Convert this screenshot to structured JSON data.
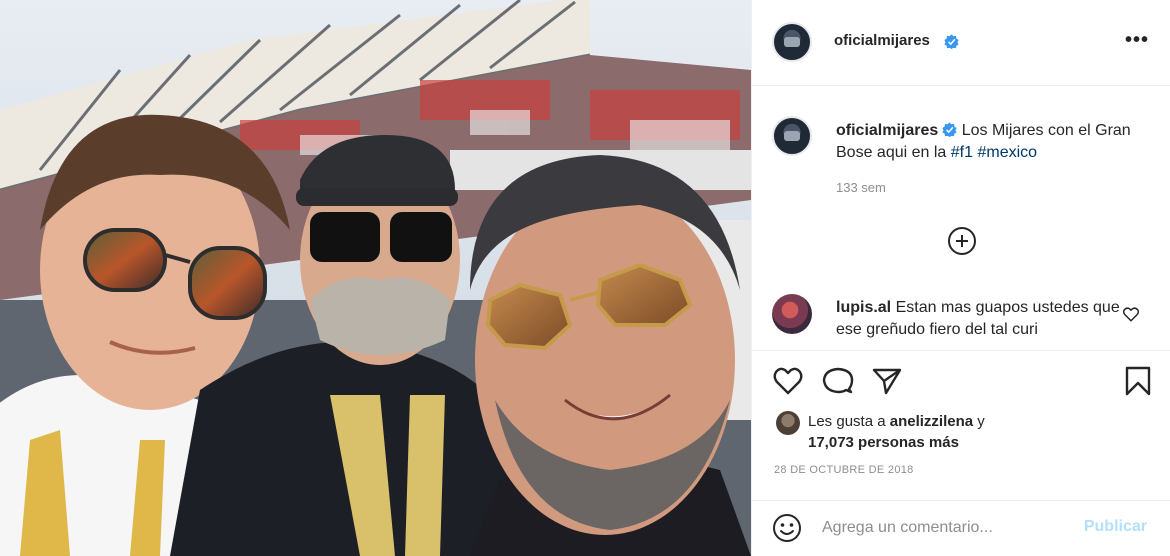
{
  "post": {
    "author": "oficialmijares",
    "verified": true,
    "more_label": "•••"
  },
  "caption": {
    "author": "oficialmijares",
    "text": "Los Mijares con el Gran Bose aqui en la",
    "hashtags": [
      "#f1",
      "#mexico"
    ],
    "time": "133 sem"
  },
  "comments": [
    {
      "user": "lupis.al",
      "text": "Estan mas guapos ustedes que ese greñudo fiero del tal curi"
    }
  ],
  "likes": {
    "prefix": "Les gusta a",
    "liker": "anelizzilena",
    "joiner": "y",
    "count": "17,073 personas más"
  },
  "date": "28 DE OCTUBRE DE 2018",
  "add_comment": {
    "placeholder": "Agrega un comentario...",
    "post_label": "Publicar"
  },
  "colors": {
    "verified": "#3897f0",
    "hashtag": "#00376b",
    "muted": "#8e8e8e",
    "post_button_disabled": "#b2dffc"
  },
  "icons": {
    "more": "more-horizontal-icon",
    "load_more": "plus-circle-icon",
    "like": "heart-icon",
    "comment": "speech-bubble-icon",
    "share": "paper-plane-icon",
    "save": "bookmark-icon",
    "emoji": "smiley-icon"
  }
}
